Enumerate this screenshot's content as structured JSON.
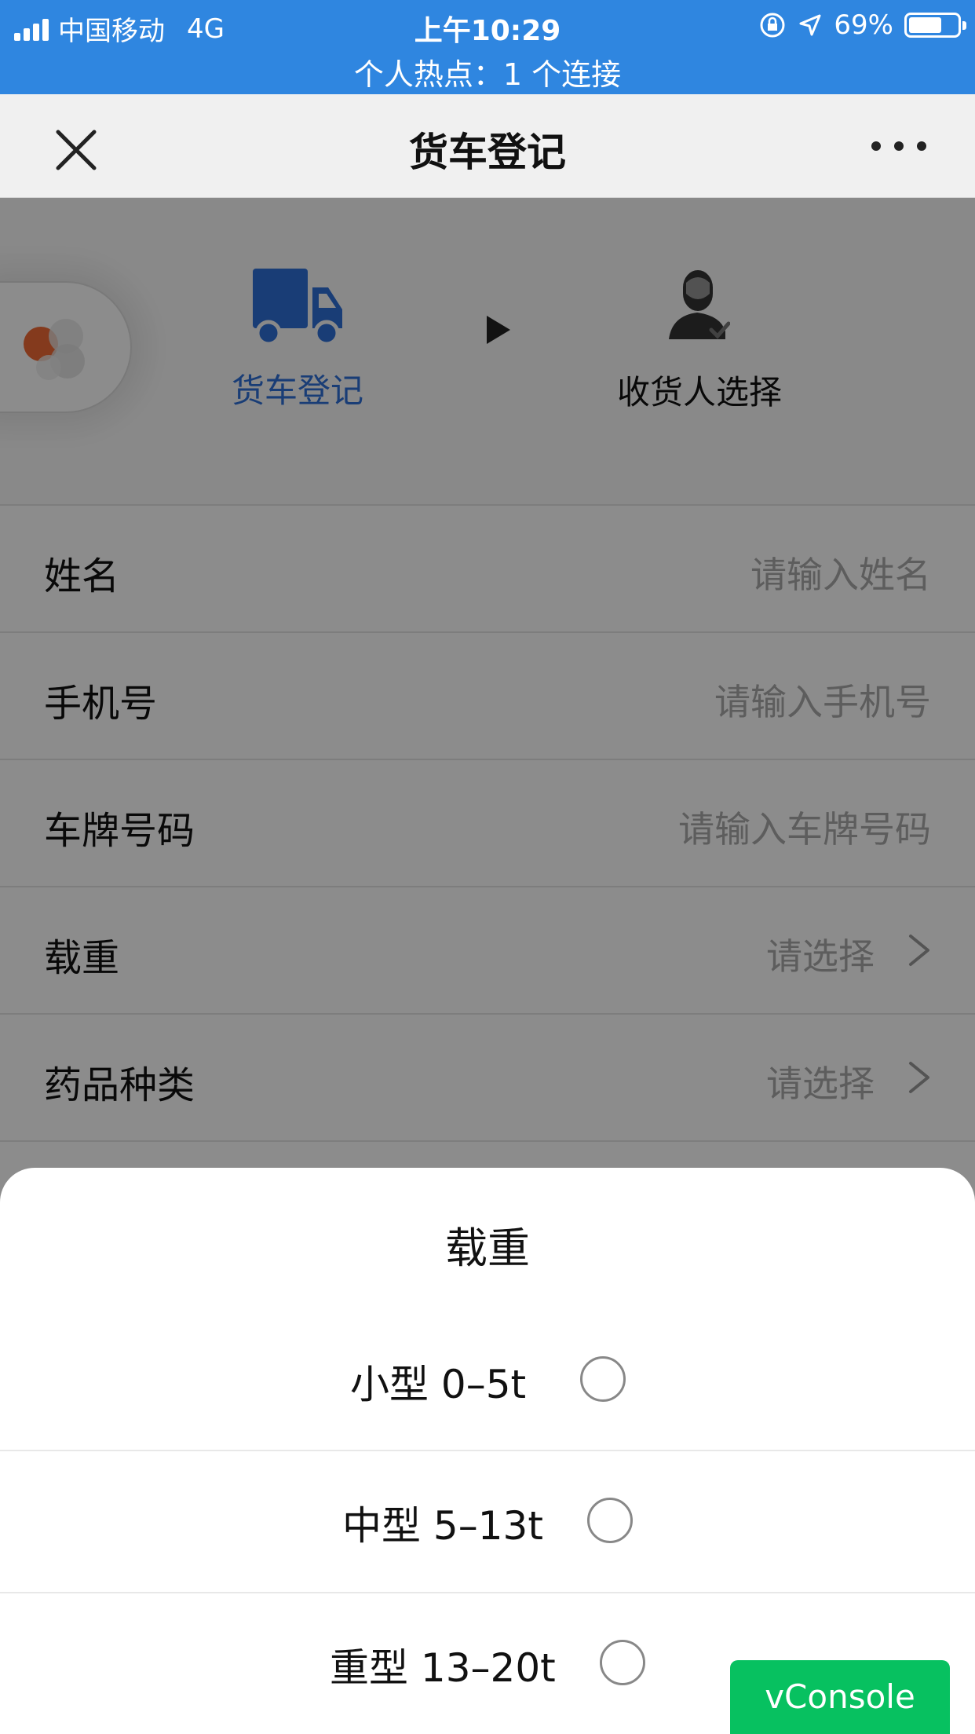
{
  "status_bar": {
    "carrier": "中国移动",
    "network": "4G",
    "time": "上午10:29",
    "battery": "69%",
    "battery_level": 0.69,
    "hotspot": "个人热点：1 个连接"
  },
  "nav": {
    "title": "货车登记",
    "close_icon": "close-icon",
    "more_icon": "more-icon"
  },
  "steps": {
    "step1_label": "货车登记",
    "step2_label": "收货人选择",
    "active_color": "#2f6fd8"
  },
  "form": {
    "name_label": "姓名",
    "name_placeholder": "请输入姓名",
    "phone_label": "手机号",
    "phone_placeholder": "请输入手机号",
    "plate_label": "车牌号码",
    "plate_placeholder": "请输入车牌号码",
    "load_label": "载重",
    "load_value": "请选择",
    "drug_label": "药品种类",
    "drug_value": "请选择"
  },
  "sheet": {
    "title": "载重",
    "options": [
      {
        "label": "小型 0–5t",
        "selected": false
      },
      {
        "label": "中型 5–13t",
        "selected": false
      },
      {
        "label": "重型 13–20t",
        "selected": false
      }
    ]
  },
  "vconsole": {
    "label": "vConsole",
    "color": "#07c160"
  }
}
